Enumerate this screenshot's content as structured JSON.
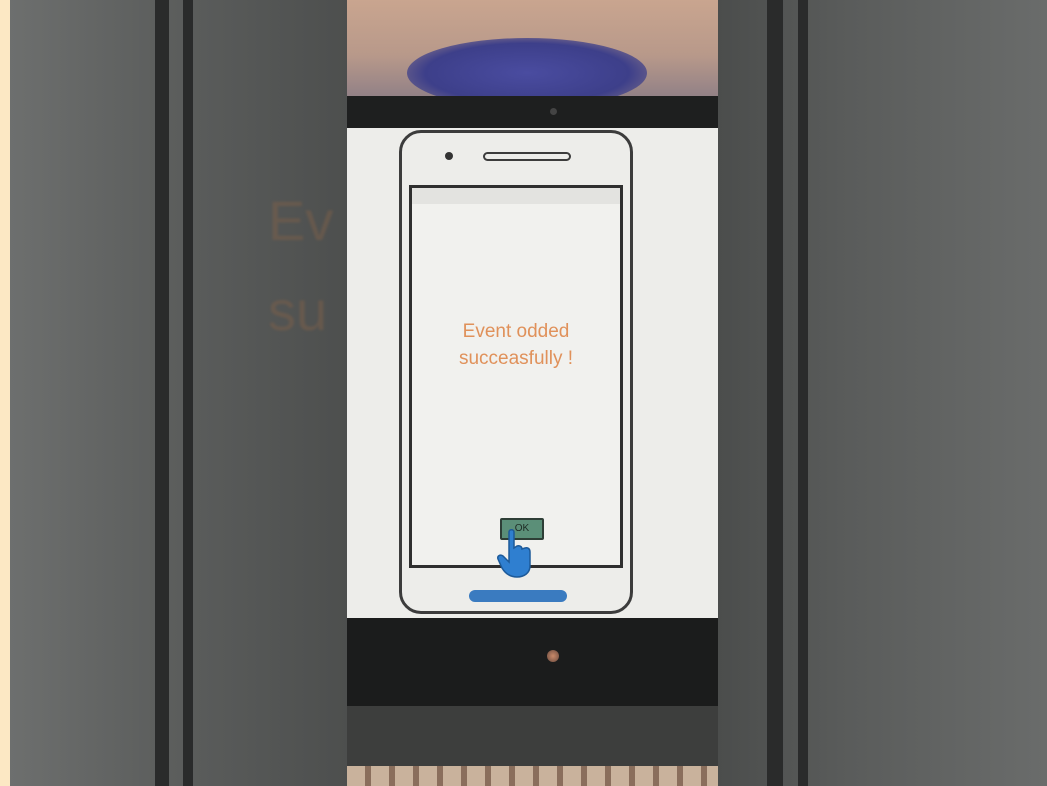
{
  "app_screen": {
    "message_line1": "Event odded",
    "message_line2": "succeasfully !",
    "ok_button_label": "OK"
  },
  "background_blurred_text": {
    "line1": "Ev",
    "line2": "su"
  },
  "icons": {
    "pointer": "hand-pointer-icon",
    "home": "home-button-icon"
  },
  "colors": {
    "message": "#e0915a",
    "ok_button": "#5b8f78",
    "hand": "#2f7fd0",
    "bottom_button": "#3a7bc0"
  }
}
